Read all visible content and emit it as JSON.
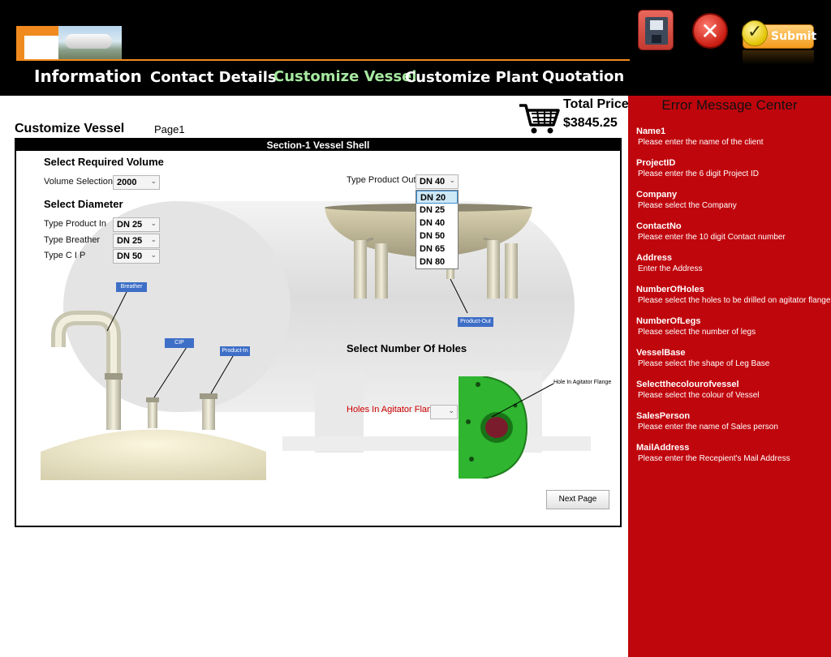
{
  "nav": {
    "tabs": [
      {
        "label": "Information"
      },
      {
        "label": "Contact Details"
      },
      {
        "label": "Customize Vessel"
      },
      {
        "label": "Customize Plant"
      },
      {
        "label": "Quotation"
      }
    ],
    "active_index": 2
  },
  "actions": {
    "submit_label": "Submit"
  },
  "page": {
    "title": "Customize Vessel",
    "page_number": "Page1"
  },
  "price": {
    "label": "Total Price",
    "value": "$3845.25"
  },
  "panel": {
    "title": "Section-1 Vessel Shell",
    "volume_heading": "Select Required Volume",
    "volume_label": "Volume Selection",
    "volume_value": "2000",
    "diameter_heading": "Select Diameter",
    "product_in_label": "Type Product In",
    "product_in_value": "DN 25",
    "breather_label": "Type Breather",
    "breather_value": "DN 25",
    "cip_label": "Type C I P",
    "cip_value": "DN 50",
    "product_out_label": "Type Product Out",
    "product_out_value": "DN 40",
    "product_out_options": [
      "DN 20",
      "DN 25",
      "DN 40",
      "DN 50",
      "DN 65",
      "DN 80"
    ],
    "product_out_highlighted": "DN 20",
    "holes_heading": "Select Number Of Holes",
    "holes_label": "Holes In Agitator Flange",
    "holes_value": "",
    "tags": {
      "breather": "Breather",
      "cip": "CIP",
      "product_in": "Product-In",
      "product_out": "Product-Out",
      "hole_flange": "Hole In Agitator Flange"
    },
    "next_label": "Next Page"
  },
  "errors": {
    "title": "Error Message Center",
    "items": [
      {
        "name": "Name1",
        "message": "Please enter the name of the client"
      },
      {
        "name": "ProjectID",
        "message": "Please enter the 6 digit Project ID"
      },
      {
        "name": "Company",
        "message": "Please select the Company"
      },
      {
        "name": "ContactNo",
        "message": "Please enter the 10 digit Contact number"
      },
      {
        "name": "Address",
        "message": "Enter the Address"
      },
      {
        "name": "NumberOfHoles",
        "message": "Please select the holes to be drilled on agitator flange"
      },
      {
        "name": "NumberOfLegs",
        "message": "Please select the number of legs"
      },
      {
        "name": "VesselBase",
        "message": "Please select the shape of Leg Base"
      },
      {
        "name": "Selectthecolourofvessel",
        "message": "Please select the colour of Vessel"
      },
      {
        "name": "SalesPerson",
        "message": "Please enter the name of Sales person"
      },
      {
        "name": "MailAddress",
        "message": "Please enter the Recepient's Mail Address"
      }
    ]
  },
  "colors": {
    "header_bg": "#000000",
    "accent_orange": "#f08a1e",
    "active_tab": "#a6e8a0",
    "error_panel": "#c0060d",
    "flange_green": "#2fb52f",
    "tag_blue": "#3e6fc7",
    "hole_label_red": "#d00000"
  },
  "icons": [
    "save-icon",
    "close-icon",
    "check-icon",
    "cart-icon",
    "chevron-down-icon"
  ]
}
